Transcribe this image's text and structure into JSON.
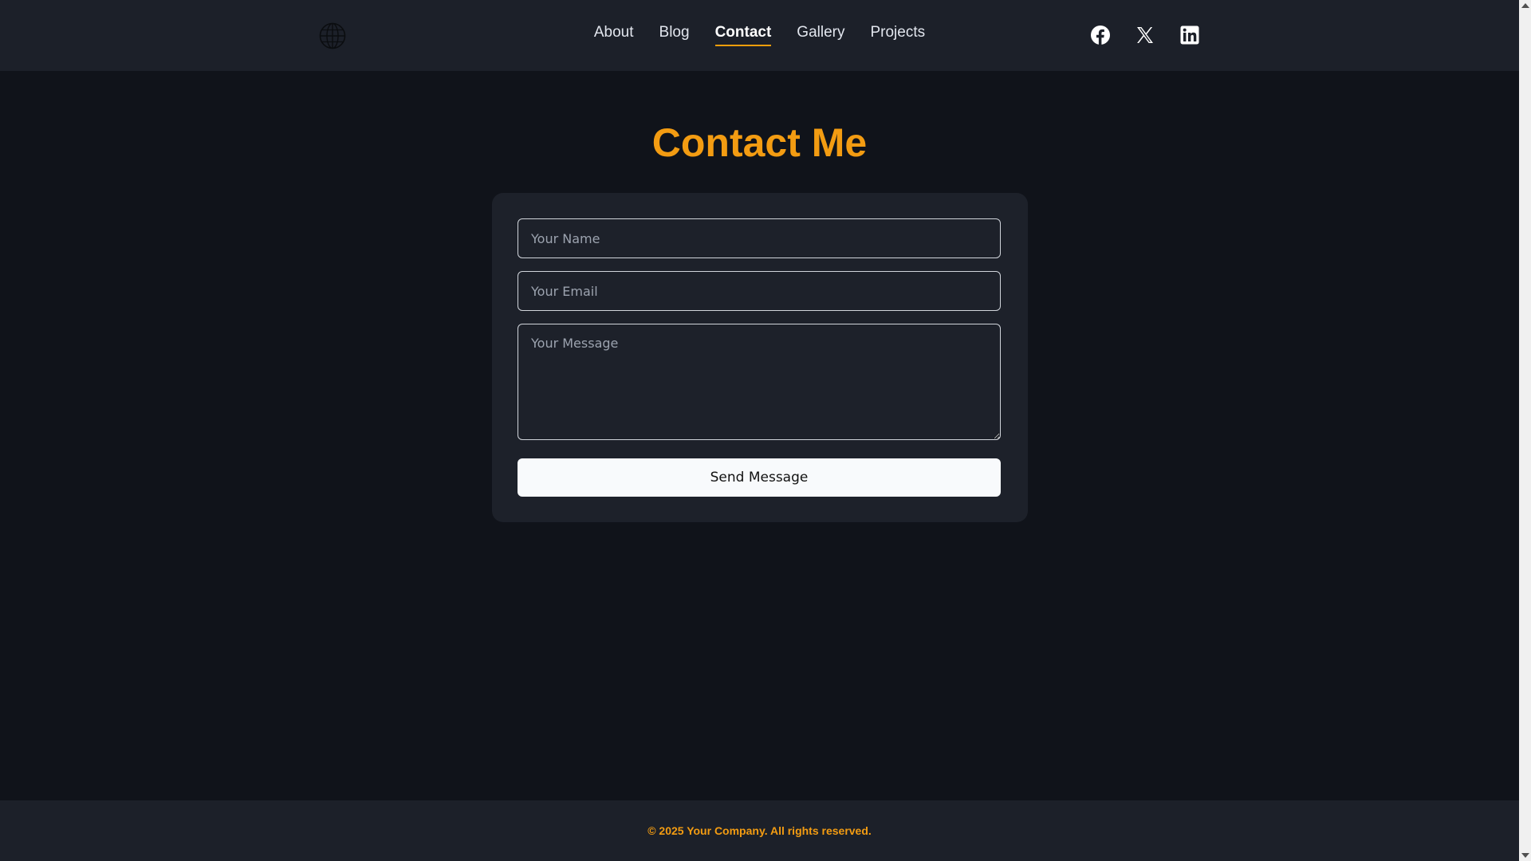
{
  "header": {
    "logo_icon": "globe-icon",
    "nav": [
      {
        "label": "About",
        "active": false
      },
      {
        "label": "Blog",
        "active": false
      },
      {
        "label": "Contact",
        "active": true
      },
      {
        "label": "Gallery",
        "active": false
      },
      {
        "label": "Projects",
        "active": false
      }
    ],
    "socials": [
      {
        "icon": "facebook-icon"
      },
      {
        "icon": "x-icon"
      },
      {
        "icon": "linkedin-icon"
      }
    ]
  },
  "main": {
    "title": "Contact Me",
    "form": {
      "name_placeholder": "Your Name",
      "name_value": "",
      "email_placeholder": "Your Email",
      "email_value": "",
      "message_placeholder": "Your Message",
      "message_value": "",
      "submit_label": "Send Message"
    }
  },
  "footer": {
    "text": "© 2025 Your Company. All rights reserved."
  },
  "colors": {
    "accent": "#f39c12",
    "header_bg": "#1c2029",
    "page_bg": "#10131a",
    "card_bg": "#1d212a"
  }
}
